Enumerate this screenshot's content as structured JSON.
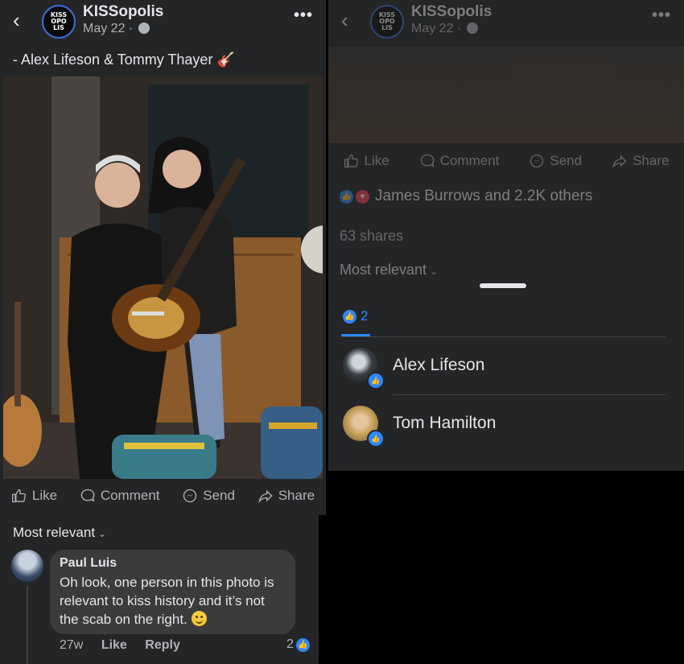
{
  "post": {
    "page_name": "KISSopolis",
    "date": "May 22 ·",
    "logo_text": [
      "KISS",
      "OPO",
      "LIS"
    ],
    "caption": "- Alex Lifeson & Tommy Thayer 🎸"
  },
  "actions": {
    "like": "Like",
    "comment": "Comment",
    "send": "Send",
    "share": "Share"
  },
  "comments": {
    "filter": "Most relevant",
    "items": [
      {
        "author": "Paul Luis",
        "text": "Oh look, one person in this photo is relevant to kiss history and it’s not the scab on the right.",
        "time": "27w",
        "like": "Like",
        "reply": "Reply",
        "reaction_count": "2"
      }
    ]
  },
  "right": {
    "reactions_summary": "James Burrows and 2.2K others",
    "shares": "63 shares",
    "filter": "Most relevant",
    "sheet": {
      "tab_count": "2",
      "people": [
        {
          "name": "Alex Lifeson"
        },
        {
          "name": "Tom Hamilton"
        }
      ]
    }
  },
  "colors": {
    "accent": "#2d88ff",
    "background": "#242526",
    "text": "#e4e6eb",
    "muted": "#b0b3b8"
  }
}
